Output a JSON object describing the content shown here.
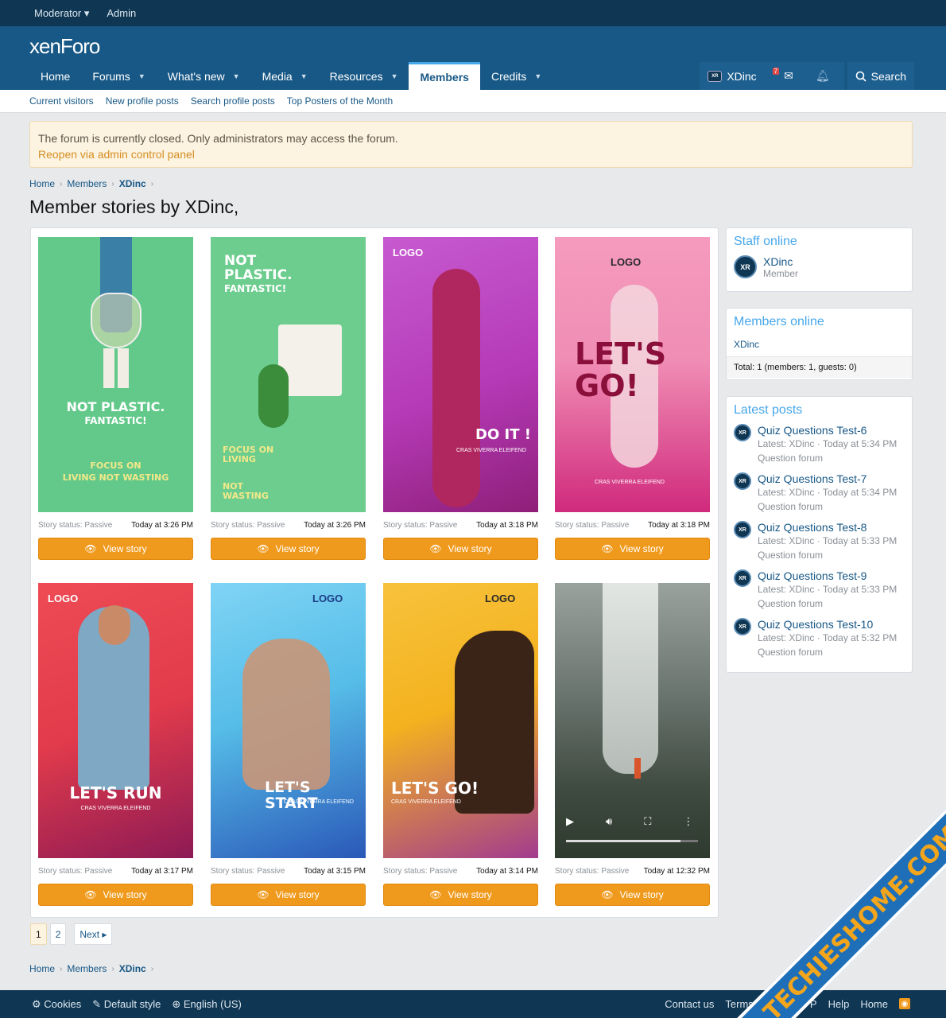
{
  "topbar": {
    "moderator": "Moderator ▾",
    "admin": "Admin"
  },
  "logo": "xenForo",
  "nav": [
    {
      "label": "Home"
    },
    {
      "label": "Forums",
      "caret": "▼"
    },
    {
      "label": "What's new",
      "caret": "▼"
    },
    {
      "label": "Media",
      "caret": "▼"
    },
    {
      "label": "Resources",
      "caret": "▼"
    },
    {
      "label": "Members"
    },
    {
      "label": "Credits",
      "caret": "▼"
    }
  ],
  "header_right": {
    "user": "XDinc",
    "badge": "7",
    "search": "Search"
  },
  "subnav": [
    "Current visitors",
    "New profile posts",
    "Search profile posts",
    "Top Posters of the Month"
  ],
  "notice": {
    "text": "The forum is currently closed. Only administrators may access the forum.",
    "link": "Reopen via admin control panel"
  },
  "breadcrumb": [
    "Home",
    "Members",
    "XDinc"
  ],
  "page_title": "Member stories by XDinc,",
  "stories": [
    {
      "status": "Story status: Passive",
      "time": "Today at 3:26 PM",
      "btn": "View story",
      "title": "NOT PLASTIC.",
      "sub": "FANTASTIC!",
      "tag1": "FOCUS ON",
      "tag2": "LIVING NOT WASTING",
      "bg": "#62c98a"
    },
    {
      "status": "Story status: Passive",
      "time": "Today at 3:26 PM",
      "btn": "View story",
      "title": "NOT PLASTIC.",
      "sub": "FANTASTIC!",
      "tag1": "FOCUS ON LIVING",
      "tag2": "NOT WASTING",
      "bg": "#6ccd8e"
    },
    {
      "status": "Story status: Passive",
      "time": "Today at 3:18 PM",
      "btn": "View story",
      "title": "DO IT !",
      "logo": "LOGO",
      "small": "CRAS VIVERRA ELEIFEND",
      "bg": "#b53ab8"
    },
    {
      "status": "Story status: Passive",
      "time": "Today at 3:18 PM",
      "btn": "View story",
      "title": "LET'S GO!",
      "logo": "LOGO",
      "small": "CRAS VIVERRA ELEIFEND",
      "bg": "#f08db4"
    },
    {
      "status": "Story status: Passive",
      "time": "Today at 3:17 PM",
      "btn": "View story",
      "title": "LET'S RUN",
      "logo": "LOGO",
      "small": "CRAS VIVERRA ELEIFEND",
      "bg": "#e23b4b"
    },
    {
      "status": "Story status: Passive",
      "time": "Today at 3:15 PM",
      "btn": "View story",
      "title": "LET'S START",
      "logo": "LOGO",
      "small": "CRAS VIVERRA ELEIFEND",
      "bg": "#56bde8"
    },
    {
      "status": "Story status: Passive",
      "time": "Today at 3:14 PM",
      "btn": "View story",
      "title": "LET'S GO!",
      "logo": "LOGO",
      "small": "CRAS VIVERRA ELEIFEND",
      "bg": "#f4b21f"
    },
    {
      "status": "Story status: Passive",
      "time": "Today at 12:32 PM",
      "btn": "View story",
      "bg": "#6b7570",
      "video": true
    }
  ],
  "pager": {
    "p1": "1",
    "p2": "2",
    "next": "Next ▸"
  },
  "staff": {
    "title": "Staff online",
    "name": "XDinc",
    "role": "Member",
    "avatar": "XR"
  },
  "members": {
    "title": "Members online",
    "name": "XDinc",
    "total": "Total: 1 (members: 1, guests: 0)"
  },
  "latest": {
    "title": "Latest posts",
    "posts": [
      {
        "title": "Quiz Questions Test-6",
        "meta": "Latest: XDinc · Today at 5:34 PM",
        "forum": "Question forum"
      },
      {
        "title": "Quiz Questions Test-7",
        "meta": "Latest: XDinc · Today at 5:34 PM",
        "forum": "Question forum"
      },
      {
        "title": "Quiz Questions Test-8",
        "meta": "Latest: XDinc · Today at 5:33 PM",
        "forum": "Question forum"
      },
      {
        "title": "Quiz Questions Test-9",
        "meta": "Latest: XDinc · Today at 5:33 PM",
        "forum": "Question forum"
      },
      {
        "title": "Quiz Questions Test-10",
        "meta": "Latest: XDinc · Today at 5:32 PM",
        "forum": "Question forum"
      }
    ]
  },
  "footer": {
    "cookies": "Cookies",
    "style": "Default style",
    "lang": "English (US)",
    "contact": "Contact us",
    "terms": "Terms and rules",
    "privacy": "P",
    "help": "Help",
    "home": "Home"
  },
  "watermark": "TECHIESHOME.COM"
}
